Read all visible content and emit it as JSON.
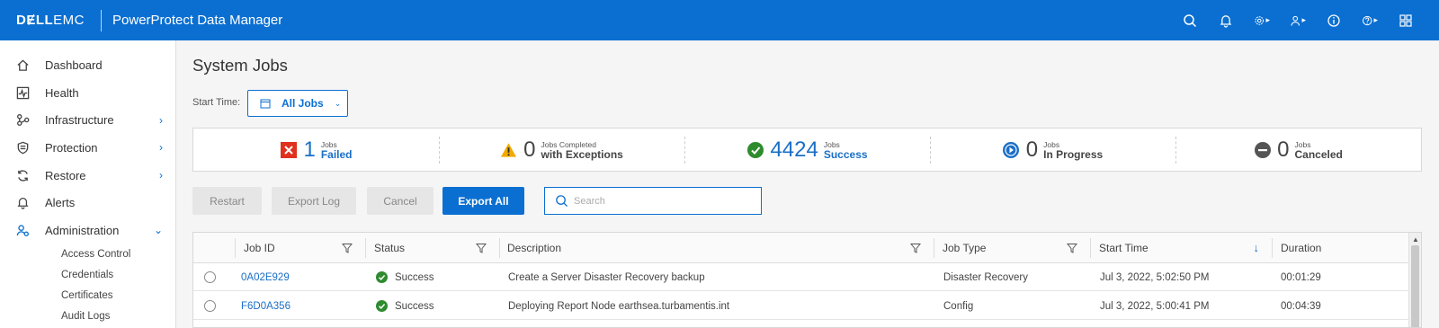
{
  "header": {
    "logo_dell": "DɆLL",
    "logo_emc": "EMC",
    "product": "PowerProtect Data Manager",
    "icons": [
      "search-icon",
      "bell-icon",
      "gear-icon",
      "user-icon",
      "info-icon",
      "help-icon",
      "apps-grid-icon"
    ]
  },
  "sidebar": {
    "items": [
      {
        "label": "Dashboard",
        "icon": "home-icon"
      },
      {
        "label": "Health",
        "icon": "health-icon"
      },
      {
        "label": "Infrastructure",
        "icon": "infrastructure-icon"
      },
      {
        "label": "Protection",
        "icon": "shield-icon"
      },
      {
        "label": "Restore",
        "icon": "restore-icon"
      },
      {
        "label": "Alerts",
        "icon": "bell-icon"
      },
      {
        "label": "Administration",
        "icon": "admin-icon"
      }
    ],
    "sub_items": [
      {
        "label": "Access Control"
      },
      {
        "label": "Credentials"
      },
      {
        "label": "Certificates"
      },
      {
        "label": "Audit Logs"
      }
    ]
  },
  "page": {
    "title": "System Jobs",
    "start_time_label": "Start Time:",
    "start_time_value": "All Jobs"
  },
  "summary": [
    {
      "count": "1",
      "small": "Jobs",
      "big": "Failed",
      "icon": "failed-icon",
      "color": "#e0301e"
    },
    {
      "count": "0",
      "small": "Jobs Completed",
      "big": "with Exceptions",
      "icon": "warning-icon",
      "color": "#f2a900"
    },
    {
      "count": "4424",
      "small": "Jobs",
      "big": "Success",
      "icon": "success-icon",
      "color": "#2e8b2e"
    },
    {
      "count": "0",
      "small": "Jobs",
      "big": "In Progress",
      "icon": "in-progress-icon",
      "color": "#1a6fc6"
    },
    {
      "count": "0",
      "small": "Jobs",
      "big": "Canceled",
      "icon": "canceled-icon",
      "color": "#555555"
    }
  ],
  "toolbar": {
    "restart": "Restart",
    "export_log": "Export Log",
    "cancel": "Cancel",
    "export_all": "Export All",
    "search_placeholder": "Search"
  },
  "table": {
    "columns": [
      "Job ID",
      "Status",
      "Description",
      "Job Type",
      "Start Time",
      "Duration"
    ],
    "rows": [
      {
        "job_id": "0A02E929",
        "status": "Success",
        "description": "Create a Server Disaster Recovery backup",
        "job_type": "Disaster Recovery",
        "start_time": "Jul 3, 2022, 5:02:50 PM",
        "duration": "00:01:29"
      },
      {
        "job_id": "F6D0A356",
        "status": "Success",
        "description": "Deploying Report Node earthsea.turbamentis.int",
        "job_type": "Config",
        "start_time": "Jul 3, 2022, 5:00:41 PM",
        "duration": "00:04:39"
      }
    ]
  },
  "colors": {
    "accent": "#0b6fd1",
    "link": "#1a6fc6",
    "success": "#2e8b2e"
  }
}
